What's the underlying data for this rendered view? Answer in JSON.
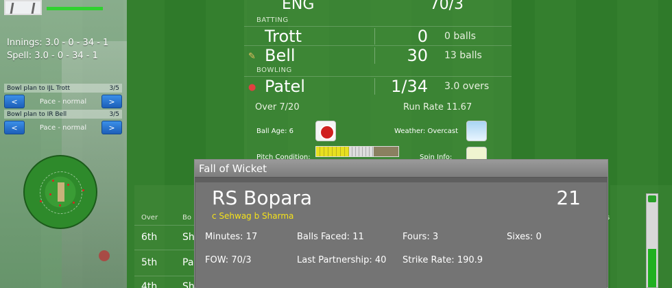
{
  "sidebar": {
    "innings": "Innings: 3.0 - 0 - 34 - 1",
    "spell": "Spell: 3.0 - 0 - 34 - 1",
    "energy_level": 1.0,
    "plans": [
      {
        "label": "Bowl plan to IJL Trott",
        "count": "3/5",
        "value": "Pace - normal",
        "prev": "<",
        "next": ">"
      },
      {
        "label": "Bowl plan to IR Bell",
        "count": "3/5",
        "value": "Pace - normal",
        "prev": "<",
        "next": ">"
      }
    ]
  },
  "scoreboard": {
    "team": "ENG",
    "score": "70/3",
    "batting_heading": "BATTING",
    "batters": [
      {
        "name": "Trott",
        "runs": "0",
        "balls": "0 balls",
        "on_strike": false
      },
      {
        "name": "Bell",
        "runs": "30",
        "balls": "13 balls",
        "on_strike": true
      }
    ],
    "bowling_heading": "BOWLING",
    "bowler": {
      "name": "Patel",
      "figures": "1/34",
      "overs": "3.0 overs"
    },
    "over": "Over 7/20",
    "run_rate": "Run Rate 11.67",
    "ball_age": "Ball Age: 6",
    "weather": "Weather: Overcast",
    "pitch_condition": "Pitch Condition:",
    "spin_info": "Spin Info:"
  },
  "table": {
    "headers": {
      "over": "Over",
      "bowler": "Bo"
    },
    "rows": [
      {
        "over": "6th",
        "bowler": "Sh"
      },
      {
        "over": "5th",
        "bowler": "Pa"
      },
      {
        "over": "4th",
        "bowler": "Sh"
      }
    ],
    "right_header": "s"
  },
  "fall_of_wicket": {
    "title": "Fall of Wicket",
    "player": "RS Bopara",
    "runs": "21",
    "dismissal": "c Sehwag b Sharma",
    "minutes": "Minutes: 17",
    "balls_faced": "Balls Faced: 11",
    "fours": "Fours: 3",
    "sixes": "Sixes: 0",
    "fow": "FOW: 70/3",
    "last_partnership": "Last Partnership: 40",
    "strike_rate": "Strike Rate: 190.9"
  },
  "colors": {
    "accent_button": "#2a7ad6",
    "dismissal_text": "#f5e21a",
    "energy": "#2fd12f"
  },
  "icons": {
    "bat": "bat-icon",
    "ball": "ball-icon",
    "weather": "weather-icon",
    "spin": "spin-icon"
  }
}
